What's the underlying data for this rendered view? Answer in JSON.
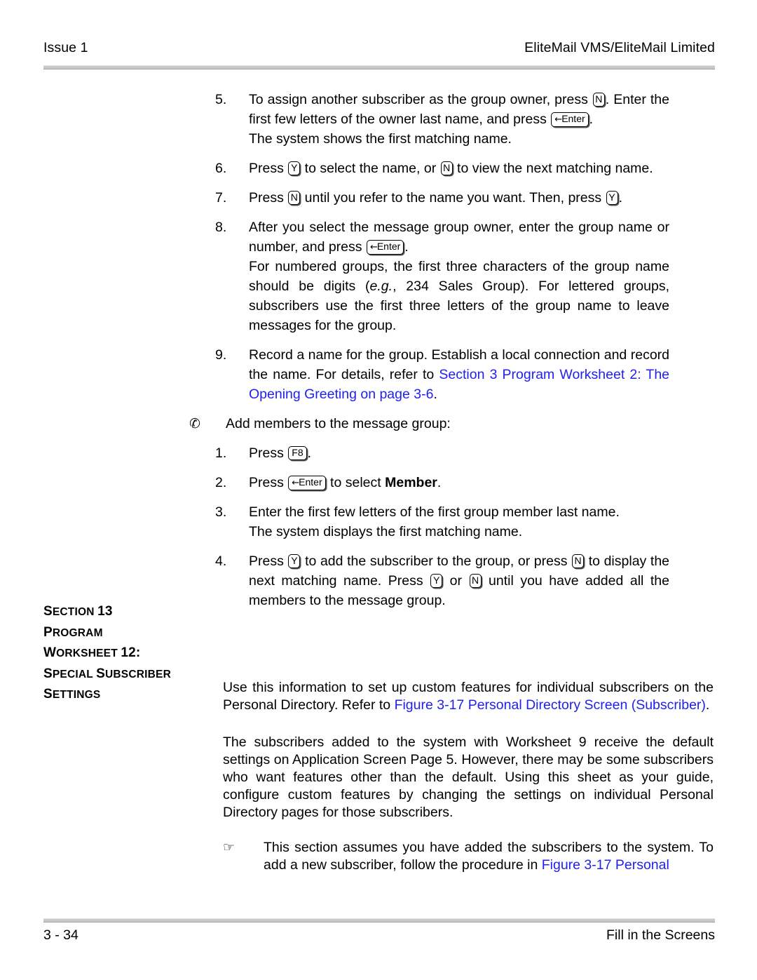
{
  "header": {
    "left": "Issue 1",
    "right": "EliteMail VMS/EliteMail Limited"
  },
  "footer": {
    "page_number": "3 - 34",
    "right": "Fill in the Screens"
  },
  "colors": {
    "link": "#2021f0",
    "rule": "#c9c9c9",
    "text": "#000000"
  },
  "keys": {
    "enter": "Enter",
    "enter_arrow": "←",
    "y": "Y",
    "n": "N",
    "f8": "F8"
  },
  "icons": {
    "bullet_dingbat": "✆",
    "note_dingbat": "☞"
  },
  "steps": {
    "s5": {
      "num": "5.",
      "l1a": "To assign another subscriber as the group owner, press ",
      "l1b": ". Enter the first few letters of the owner last name, and press ",
      "l1c": ".",
      "l2": "The system shows the first matching name."
    },
    "s6": {
      "num": "6.",
      "a": "Press ",
      "b": " to select the name, or ",
      "c": " to view the next matching name."
    },
    "s7": {
      "num": "7.",
      "a": "Press ",
      "b": " until you refer to the name you want.  Then, press ",
      "c": "."
    },
    "s8": {
      "num": "8.",
      "a": "After you select the message group owner, enter the group name or number, and press ",
      "b": ".",
      "l2a": "For numbered groups, the first three characters of the group name should be digits (",
      "l2_italic": "e.g.",
      "l2b": ", 234 Sales Group).  For lettered groups, subscribers use the first three letters of the group name to leave messages for the group."
    },
    "s9": {
      "num": "9.",
      "a": "Record a name for the group.  Establish a local connection and record the name. For details, refer to ",
      "link": "Section 3 Program Worksheet 2: The Opening Greeting on page 3-6",
      "b": "."
    }
  },
  "bullet_group": {
    "heading": "Add members to the message group:",
    "b1": {
      "num": "1.",
      "a": "Press ",
      "b": "."
    },
    "b2": {
      "num": "2.",
      "a": "Press ",
      "b": " to select ",
      "bold": "Member",
      "c": "."
    },
    "b3": {
      "num": "3.",
      "l1": "Enter the first few letters of the first group member last name.",
      "l2": "The system displays the first matching name."
    },
    "b4": {
      "num": "4.",
      "a": "Press ",
      "b": " to add the subscriber to the group, or press ",
      "c": " to display the next matching name. Press ",
      "d": " or ",
      "e": " until you have added all the members to the message group."
    }
  },
  "section": {
    "line1_first": "S",
    "line1_rest": "ECTION ",
    "line1_num": "13",
    "line2_first": "P",
    "line2_rest": "ROGRAM",
    "line3_first": "W",
    "line3_rest": "ORKSHEET ",
    "line3_num": "12:",
    "line4_first": "S",
    "line4_rest": "PECIAL ",
    "line4_first2": "S",
    "line4_rest2": "UBSCRIBER",
    "line5_first": "S",
    "line5_rest": "ETTINGS",
    "para1_a": "Use this information to set up custom features for individual subscribers on the Personal Directory. Refer to ",
    "para1_link": "Figure 3-17 Personal Directory Screen (Subscriber)",
    "para1_b": ".",
    "para2": "The subscribers added to the system with Worksheet 9 receive the default settings on Application Screen Page 5.  However, there may be some subscribers who want features other than the default. Using this sheet as your guide, configure custom features by changing the settings on individual Personal Directory pages for those subscribers.",
    "note_a": "This section assumes you have added the subscribers to the system.  To add a new subscriber, follow the procedure in ",
    "note_link": "Figure 3-17 Personal"
  }
}
